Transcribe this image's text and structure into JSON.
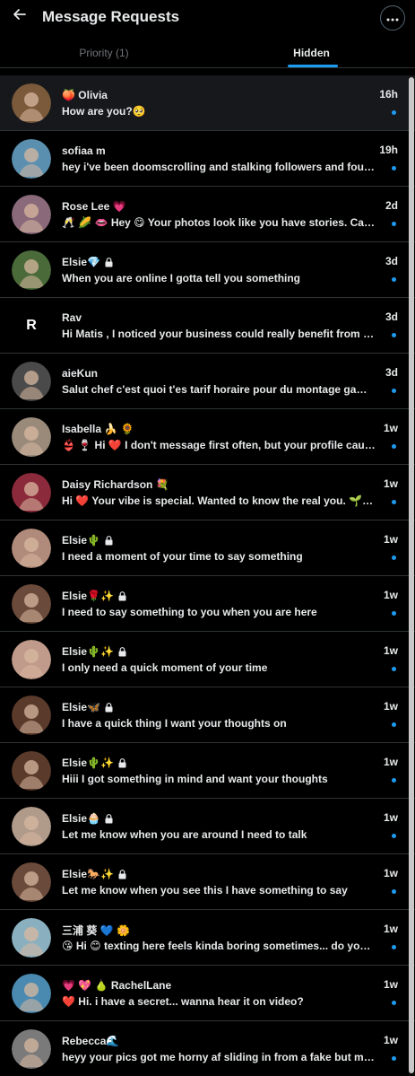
{
  "header": {
    "title": "Message Requests",
    "back_icon": "arrow-left-icon",
    "more_icon": "more-horizontal-icon"
  },
  "tabs": [
    {
      "label": "Priority (1)",
      "selected": false
    },
    {
      "label": "Hidden",
      "selected": true
    }
  ],
  "colors": {
    "accent": "#1d9bf0",
    "background": "#000000",
    "text": "#e7e9ea",
    "muted": "#71767b",
    "divider": "#2f3336"
  },
  "requests": [
    {
      "name": "🍑 Olivia",
      "locked": false,
      "time": "16h",
      "preview": "How are you?🥺",
      "avatar_color": "#7a5a3a"
    },
    {
      "name": "sofiaa m",
      "locked": false,
      "time": "19h",
      "preview": "hey i've been doomscrolling and stalking followers and found you, wanna chat?",
      "avatar_color": "#5a8fb0"
    },
    {
      "name": "Rose Lee 💗",
      "locked": false,
      "time": "2d",
      "preview": "🥂 🌽 👄 Hey 😋 Your photos look like you have stories. Can we talk?",
      "avatar_color": "#8a6a7a"
    },
    {
      "name": "Elsie💎",
      "locked": true,
      "time": "3d",
      "preview": "When you are online I gotta tell you something",
      "avatar_color": "#4a6a3a"
    },
    {
      "name": "Rav",
      "locked": false,
      "time": "3d",
      "preview": "Hi Matis , I noticed your business could really benefit from having a website",
      "avatar_color": "#000000",
      "avatar_letter": "R"
    },
    {
      "name": "aieKun",
      "locked": false,
      "time": "3d",
      "preview": "Salut chef c'est quoi t'es tarif horaire pour du montage gaming et vlog ?",
      "avatar_color": "#4a4a4a"
    },
    {
      "name": "Isabella 🍌 🌻",
      "locked": false,
      "time": "1w",
      "preview": "👙 🍷 Hi ❤️ I don't message first often, but your profile caught my attention",
      "avatar_color": "#9a8a7a"
    },
    {
      "name": "Daisy Richardson 💐",
      "locked": false,
      "time": "1w",
      "preview": "Hi ❤️ Your vibe is special. Wanted to know the real you. 🌱 🔥",
      "avatar_color": "#8a2a3a"
    },
    {
      "name": "Elsie🌵",
      "locked": true,
      "time": "1w",
      "preview": "I need a moment of your time to say something",
      "avatar_color": "#b08a7a"
    },
    {
      "name": "Elsie🌹✨",
      "locked": true,
      "time": "1w",
      "preview": "I need to say something to you when you are here",
      "avatar_color": "#6a4a3a"
    },
    {
      "name": "Elsie🌵✨",
      "locked": true,
      "time": "1w",
      "preview": "I only need a quick moment of your time",
      "avatar_color": "#c09a8a"
    },
    {
      "name": "Elsie🦋",
      "locked": true,
      "time": "1w",
      "preview": "I have a quick thing I want your thoughts on",
      "avatar_color": "#5a3a2a"
    },
    {
      "name": "Elsie🌵✨",
      "locked": true,
      "time": "1w",
      "preview": "Hiii I got something in mind and want your thoughts",
      "avatar_color": "#5a3a2a"
    },
    {
      "name": "Elsie🧁",
      "locked": true,
      "time": "1w",
      "preview": "Let me know when you are around I need to talk",
      "avatar_color": "#b09a8a"
    },
    {
      "name": "Elsie🐎✨",
      "locked": true,
      "time": "1w",
      "preview": "Let me know when you see this I have something to say",
      "avatar_color": "#6a4a3a"
    },
    {
      "name": "三浦 葵 💙 🌼",
      "locked": false,
      "time": "1w",
      "preview": "😘 Hi 😊 texting here feels kinda boring sometimes... do you ever feel that?",
      "avatar_color": "#8ab0c0"
    },
    {
      "name": "💗 💖 🍐 RachelLane",
      "locked": false,
      "time": "1w",
      "preview": "❤️ Hi. i have a secret... wanna hear it on video?",
      "avatar_color": "#4a8ab0"
    },
    {
      "name": "Rebecca🌊",
      "locked": false,
      "time": "1w",
      "preview": "heyy your pics got me horny af sliding in from a fake but my real is on my profile",
      "avatar_color": "#7a7a7a"
    }
  ]
}
